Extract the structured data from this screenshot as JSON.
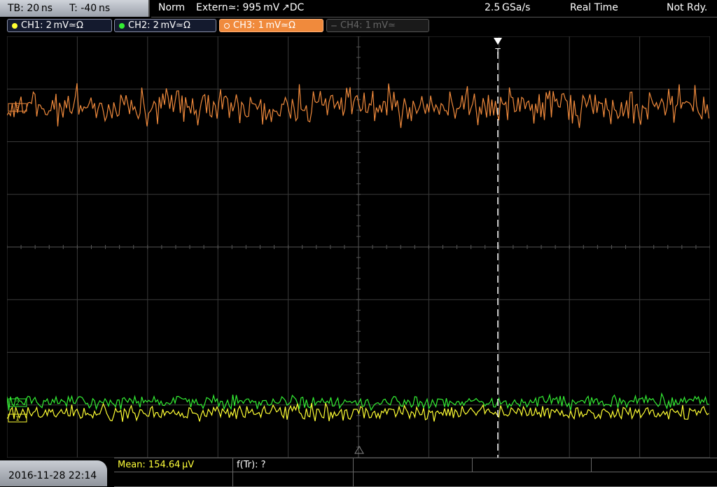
{
  "topbar": {
    "timebase": "TB: 20 ns",
    "trigger_time": "T: -40 ns",
    "mode": "Norm",
    "trigger_source": "Extern≃: 995 mV ↗DC",
    "sample_rate": "2.5 GSa/s",
    "acq_mode": "Real Time",
    "status": "Not Rdy."
  },
  "channels": [
    {
      "label": "CH1: 2 mV≃Ω",
      "color": "#ffff33",
      "active": true
    },
    {
      "label": "CH2: 2 mV≃Ω",
      "color": "#33ee33",
      "active": true
    },
    {
      "label": "CH3: 1 mV≃Ω",
      "color": "#f08a3c",
      "active": true
    },
    {
      "label": "CH4: 1 mV≃",
      "color": "#777777",
      "active": false
    }
  ],
  "trigger_marker": "T",
  "ref_markers": {
    "ch3": "3",
    "ch2": "2",
    "ch1": "1"
  },
  "bottom": {
    "datetime": "2016-11-28 22:14",
    "measurements": [
      {
        "label": "Mean: 154.64 µV",
        "color": "#ffff3a"
      },
      {
        "label": "f(Tr): ?",
        "color": "#ffffff"
      }
    ]
  },
  "colors": {
    "ch1": "#ffff33",
    "ch2": "#33ee33",
    "ch3": "#f08a3c",
    "grid": "#3a3a3a",
    "trigger_line": "#ffffff"
  }
}
